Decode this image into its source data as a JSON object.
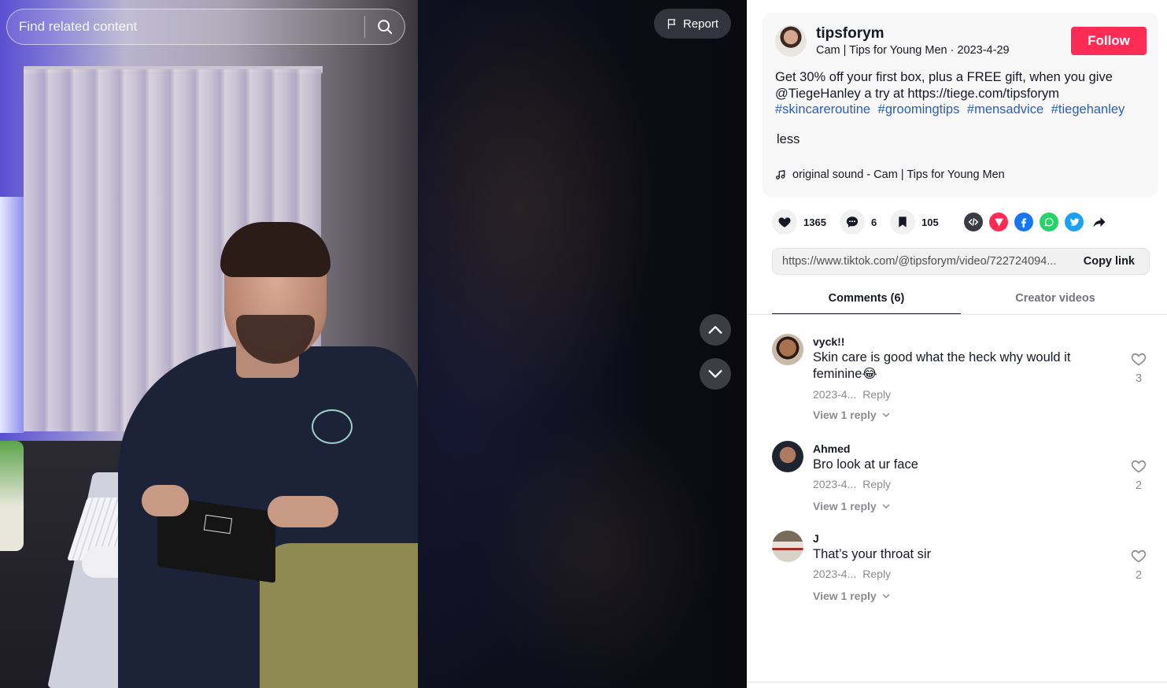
{
  "search": {
    "placeholder": "Find related content"
  },
  "video": {
    "report_label": "Report"
  },
  "author": {
    "username": "tipsforym",
    "subtitle": "Cam | Tips for Young Men · 2023-4-29",
    "follow_label": "Follow"
  },
  "description": {
    "text": "Get 30% off your first box, plus a FREE gift, when you give @TiegeHanley a try at https://tiege.com/tipsforym",
    "hashtags": [
      "#skincareroutine",
      "#groomingtips",
      "#mensadvice",
      "#tiegehanley"
    ],
    "less_label": "less",
    "music": "original sound - Cam | Tips for Young Men"
  },
  "actions": {
    "likes": "1365",
    "comments": "6",
    "saves": "105"
  },
  "share_icons": [
    "embed-icon",
    "send-icon",
    "facebook-icon",
    "whatsapp-icon",
    "twitter-icon",
    "share-arrow-icon"
  ],
  "copy_link": {
    "url": "https://www.tiktok.com/@tipsforym/video/722724094...",
    "button_label": "Copy link"
  },
  "tabs": [
    {
      "label": "Comments (6)",
      "active": true
    },
    {
      "label": "Creator videos",
      "active": false
    }
  ],
  "comments": [
    {
      "user": "vyck!!",
      "text": "Skin care is good what the heck why would it feminine😂",
      "date": "2023-4...",
      "reply_label": "Reply",
      "view_replies": "View 1 reply",
      "likes": "3"
    },
    {
      "user": "Ahmed",
      "text": "Bro look at ur face",
      "date": "2023-4...",
      "reply_label": "Reply",
      "view_replies": "View 1 reply",
      "likes": "2"
    },
    {
      "user": "J",
      "text": "That’s your throat sir",
      "date": "2023-4...",
      "reply_label": "Reply",
      "view_replies": "View 1 reply",
      "likes": "2"
    }
  ],
  "colors": {
    "accent": "#fe2c55",
    "hashtag": "#2b5db9",
    "text": "#161823",
    "muted": "#8a8b91"
  }
}
